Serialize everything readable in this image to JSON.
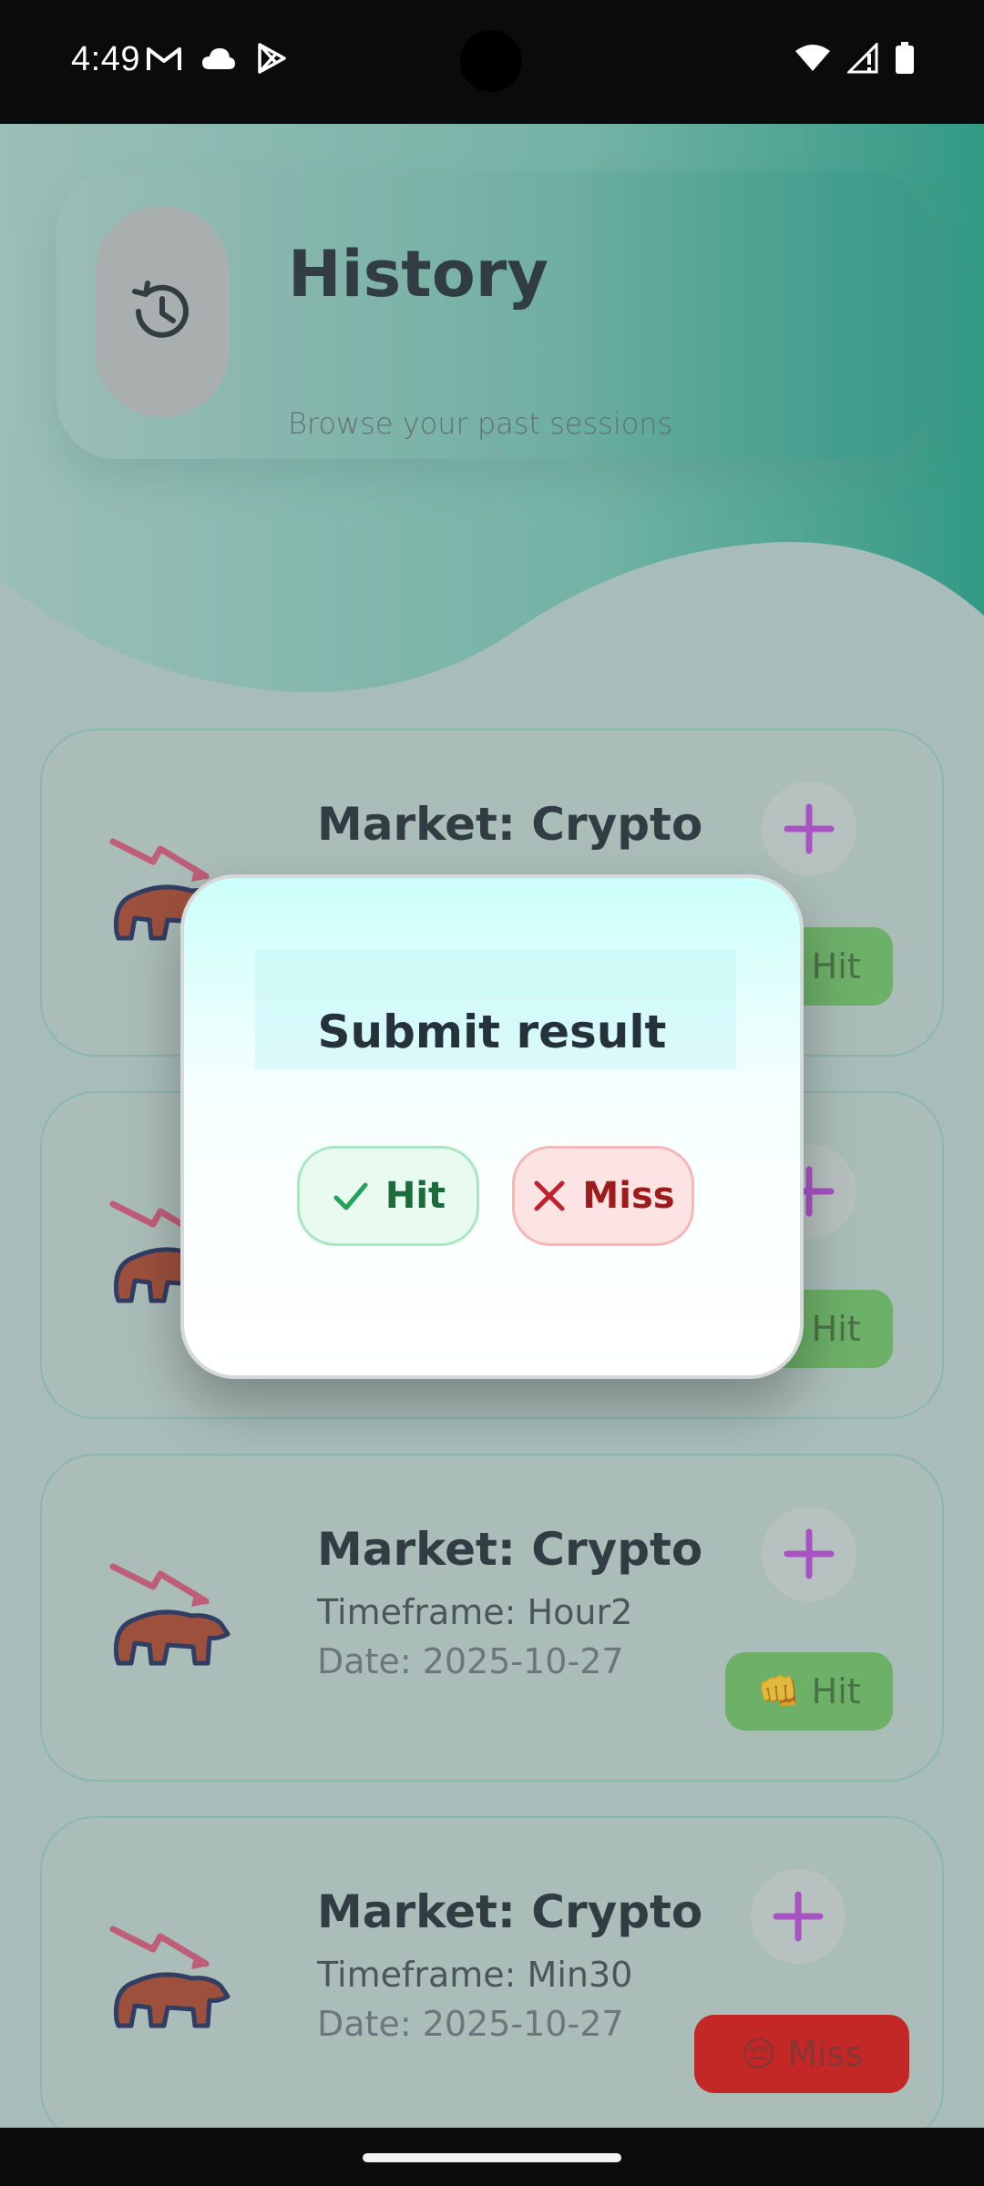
{
  "status_bar": {
    "time": "4:49",
    "left_icons": [
      "gmail-icon",
      "cloud-icon",
      "play-store-icon"
    ],
    "right_icons": [
      "wifi-icon",
      "signal-icon",
      "battery-icon"
    ]
  },
  "header": {
    "title": "History",
    "subtitle": "Browse your past sessions",
    "icon": "history-icon"
  },
  "sessions": [
    {
      "title": "Market: Crypto",
      "timeframe": "",
      "date": "",
      "result": "Hit",
      "result_emoji": "👊"
    },
    {
      "title": "",
      "timeframe": "",
      "date": "",
      "result": "Hit",
      "result_emoji": "👊"
    },
    {
      "title": "Market: Crypto",
      "timeframe": "Timeframe: Hour2",
      "date": "Date: 2025-10-27",
      "result": "Hit",
      "result_emoji": "👊"
    },
    {
      "title": "Market: Crypto",
      "timeframe": "Timeframe: Min30",
      "date": "Date: 2025-10-27",
      "result": "Miss",
      "result_emoji": "😔"
    }
  ],
  "dialog": {
    "title": "Submit result",
    "hit_label": "Hit",
    "miss_label": "Miss"
  },
  "colors": {
    "accent_teal": "#1fa089",
    "hit_green": "#6bbd62",
    "miss_red": "#d90f0f",
    "plus_purple": "#b546d6"
  }
}
